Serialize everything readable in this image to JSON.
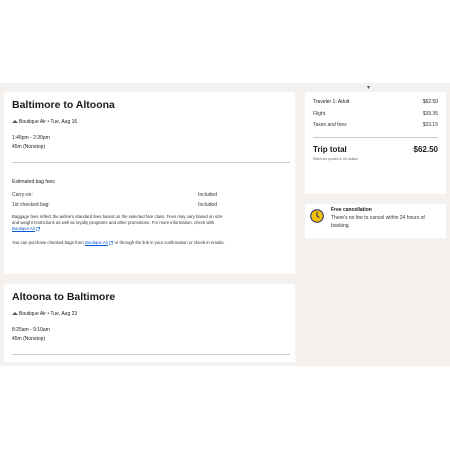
{
  "outbound": {
    "title": "Baltimore to Altoona",
    "airline_date": "Boutique Air • Tue, Aug 16",
    "times": "1:45pm - 2:30pm",
    "duration": "45m (Nonstop)",
    "bag_fees_title": "Estimated bag fees",
    "carry_on_label": "Carry-on:",
    "carry_on_value": "Included",
    "checked_label": "1st checked bag:",
    "checked_value": "Included",
    "disclaimer_1": "Baggage fees reflect the airline's standard fees based on the selected fare class. Fees may vary based on size and weight restrictions as well as loyalty programs and other promotions. For more information, check with",
    "disclaimer_link": "Boutique Air",
    "disclaimer_2_pre": "You can purchase checked bags from",
    "disclaimer_2_link": "Boutique Air",
    "disclaimer_2_post": "or through the link in your confirmation or check-in emails."
  },
  "return": {
    "title": "Altoona to Baltimore",
    "airline_date": "Boutique Air • Tue, Aug 23",
    "times": "8:25am - 9:10am",
    "duration": "45m (Nonstop)"
  },
  "summary": {
    "traveler_label": "Traveler 1: Adult",
    "traveler_value": "$62.50",
    "flight_label": "Flight",
    "flight_value": "$39.35",
    "taxes_label": "Taxes and fees",
    "taxes_value": "$23.15",
    "total_label": "Trip total",
    "total_value": "$62.50",
    "currency_note": "Rates are quoted in US dollars"
  },
  "cancellation": {
    "title": "Free cancellation",
    "text": "There's no fee to cancel within 24 hours of booking."
  },
  "colors": {
    "accent": "#0a5bd3",
    "cancel_icon": "#f2c200"
  }
}
